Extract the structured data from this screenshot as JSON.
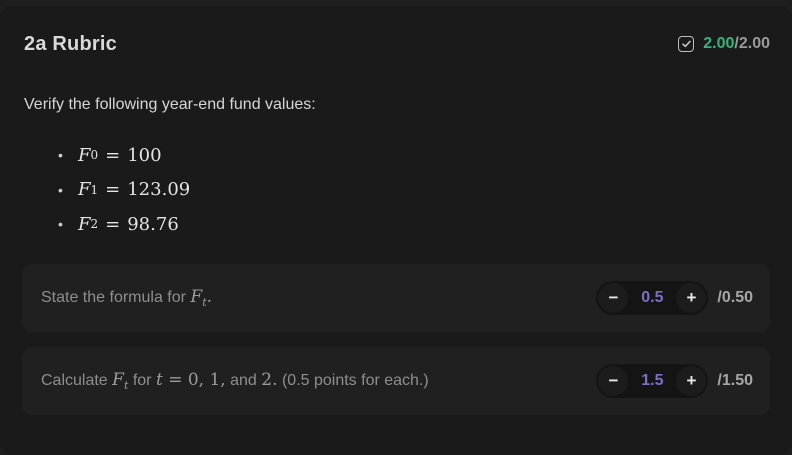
{
  "rubric": {
    "title": "2a Rubric",
    "score": {
      "earned": "2.00",
      "separator": "/",
      "total": "2.00",
      "earned_color": "#34b37a"
    },
    "check_icon": "checkbox-checked-icon"
  },
  "question": {
    "intro": "Verify the following year-end fund values:",
    "fund_values": [
      {
        "var": "F",
        "sub": "0",
        "value": "100"
      },
      {
        "var": "F",
        "sub": "1",
        "value": "123.09"
      },
      {
        "var": "F",
        "sub": "2",
        "value": "98.76"
      }
    ]
  },
  "criteria": [
    {
      "text_before": "State the formula for ",
      "math_var": "F",
      "math_sub": "t",
      "text_after": ".",
      "value": "0.5",
      "minus_label": "−",
      "plus_label": "+",
      "max": "/0.50"
    },
    {
      "text_before": "Calculate ",
      "math_var": "F",
      "math_sub": "t",
      "text_mid": " for ",
      "math_expr": "t = 0, 1,",
      "text_and": " and ",
      "math_two": "2.",
      "text_after": " (0.5 points for each.)",
      "value": "1.5",
      "minus_label": "−",
      "plus_label": "+",
      "max": "/1.50"
    }
  ]
}
